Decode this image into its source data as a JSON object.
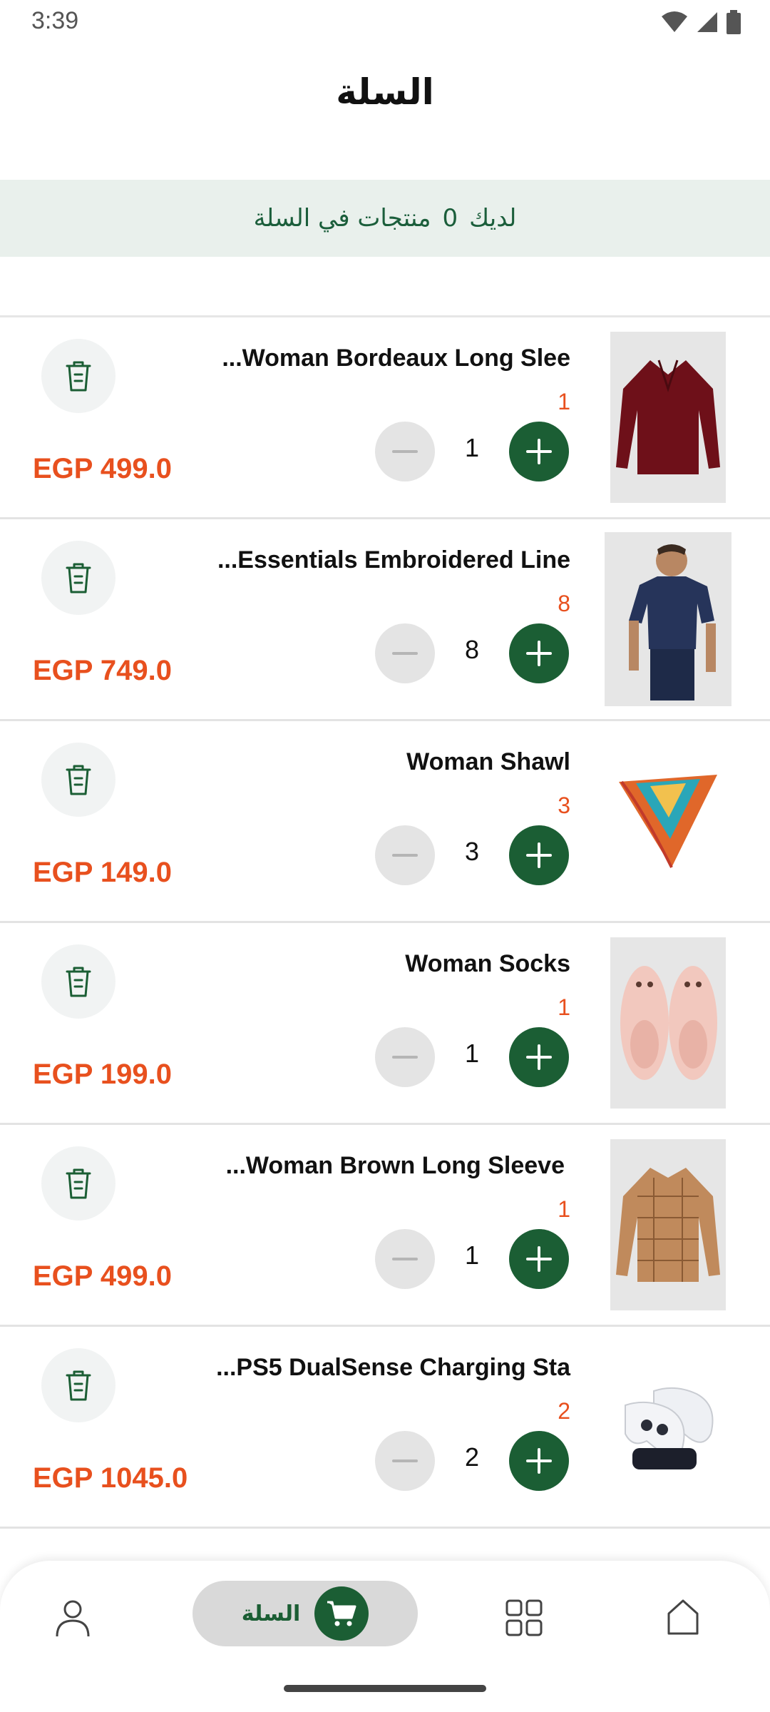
{
  "status_bar": {
    "time": "3:39"
  },
  "header": {
    "title": "السلة"
  },
  "banner": {
    "prefix": "لديك",
    "count": "0",
    "suffix": "منتجات في السلة"
  },
  "items": [
    {
      "name": "...Woman Bordeaux Long Slee",
      "qty_label": "1",
      "qty": "1",
      "price": "EGP 499.0"
    },
    {
      "name": "...Essentials Embroidered Line",
      "qty_label": "8",
      "qty": "8",
      "price": "EGP 749.0"
    },
    {
      "name": "Woman Shawl",
      "qty_label": "3",
      "qty": "3",
      "price": "EGP 149.0"
    },
    {
      "name": "Woman Socks",
      "qty_label": "1",
      "qty": "1",
      "price": "EGP 199.0"
    },
    {
      "name": "...Woman Brown Long Sleeve",
      "qty_label": "1",
      "qty": "1",
      "price": "EGP 499.0"
    },
    {
      "name": "...PS5 DualSense Charging Sta",
      "qty_label": "2",
      "qty": "2",
      "price": "EGP 1045.0"
    }
  ],
  "bottom_nav": {
    "cart_label": "السلة"
  },
  "colors": {
    "accent": "#1b5e34",
    "price": "#e8501e",
    "banner_bg": "#e9f0ec"
  },
  "icons": [
    "trash-icon",
    "minus-icon",
    "plus-icon",
    "profile-icon",
    "cart-icon",
    "grid-icon",
    "home-icon",
    "wifi-icon",
    "signal-icon",
    "battery-icon"
  ]
}
